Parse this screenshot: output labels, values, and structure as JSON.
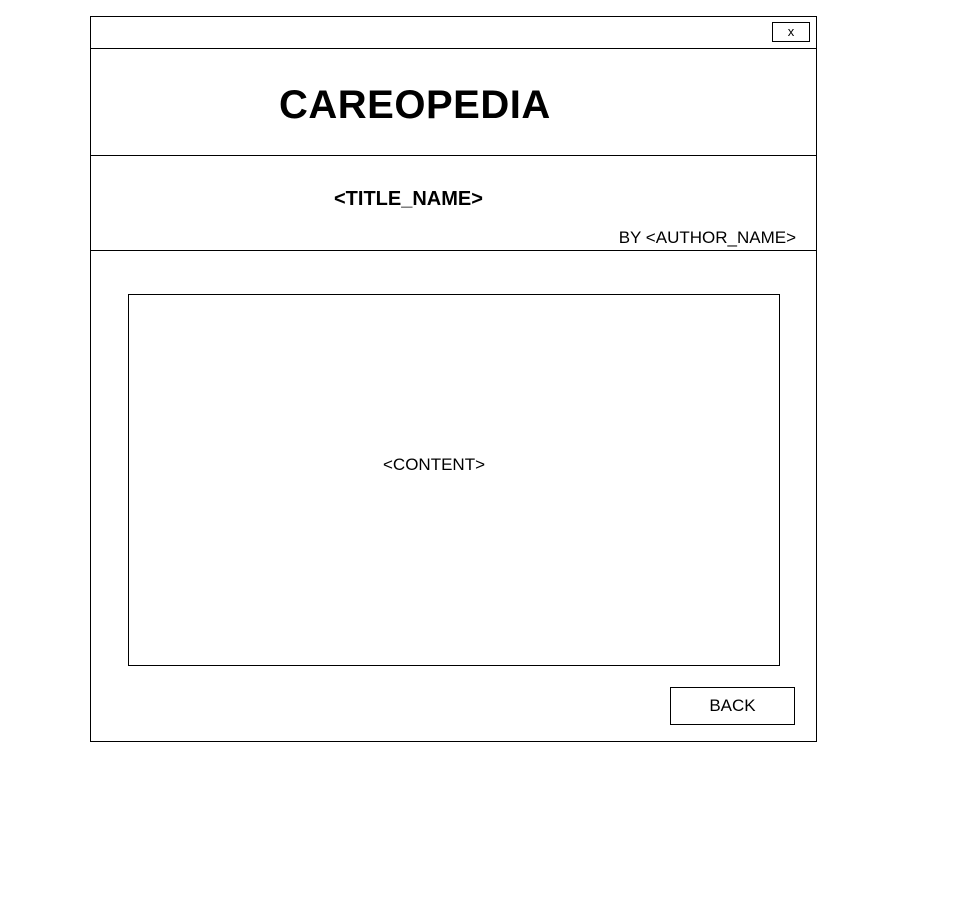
{
  "window": {
    "close_label": "x"
  },
  "header": {
    "app_title": "CAREOPEDIA"
  },
  "article": {
    "title": "<TITLE_NAME>",
    "author_line": "BY <AUTHOR_NAME>",
    "content": "<CONTENT>"
  },
  "footer": {
    "back_label": "BACK"
  }
}
